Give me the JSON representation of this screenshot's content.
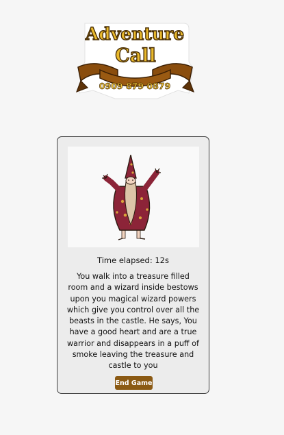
{
  "header": {
    "logo_word_1": "Adventure",
    "logo_word_2": "Call",
    "logo_phone": "0909 879 0879"
  },
  "game": {
    "time_elapsed": "Time elapsed: 12s",
    "story_text": "You walk into a treasure filled room and a wizard inside bestows upon you magical wizard powers which give you control over all the beasts in the castle. He says, You have a good heart and are a true warrior and disappears in a puff of smoke leaving the treasure and castle to you",
    "illustration": "wizard",
    "end_button_label": "End Game"
  },
  "colors": {
    "page_background": "#f6f6f6",
    "card_background": "#ececec",
    "button_brown": "#8b5a14",
    "logo_gold": "#e9b92c",
    "robe_maroon": "#8c2438"
  }
}
